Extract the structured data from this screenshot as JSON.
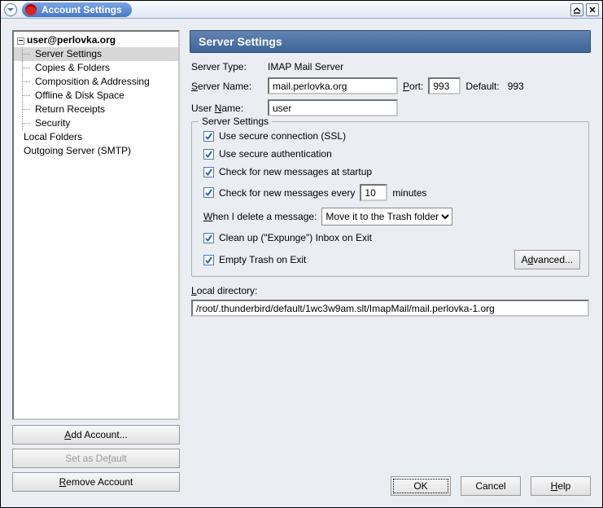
{
  "window": {
    "title": "Account Settings",
    "icons": {
      "dropdown": "dropdown-icon",
      "minimize": "minimize-icon",
      "close": "close-icon"
    }
  },
  "tree": {
    "account": "user@perlovka.org",
    "items": [
      "Server Settings",
      "Copies & Folders",
      "Composition & Addressing",
      "Offline & Disk Space",
      "Return Receipts",
      "Security"
    ],
    "selected_index": 0,
    "extra": [
      "Local Folders",
      "Outgoing Server (SMTP)"
    ]
  },
  "sidebar_buttons": {
    "add": "Add Account...",
    "set_default": "Set as Default",
    "remove": "Remove Account"
  },
  "panel": {
    "title": "Server Settings",
    "server_type_label": "Server Type:",
    "server_type_value": "IMAP Mail Server",
    "server_name_label": "Server Name:",
    "server_name_value": "mail.perlovka.org",
    "port_label": "Port:",
    "port_value": "993",
    "default_label": "Default:",
    "default_value": "993",
    "user_name_label": "User Name:",
    "user_name_value": "user"
  },
  "server_settings": {
    "legend": "Server Settings",
    "ssl": "Use secure connection (SSL)",
    "auth": "Use secure authentication",
    "check_startup": "Check for new messages at startup",
    "check_every_pre": "Check for new messages every",
    "check_every_value": "10",
    "check_every_post": "minutes",
    "delete_label": "When I delete a message:",
    "delete_value": "Move it to the Trash folder",
    "expunge": "Clean up (\"Expunge\") Inbox on Exit",
    "empty_trash": "Empty Trash on Exit",
    "advanced": "Advanced..."
  },
  "local": {
    "label": "Local directory:",
    "value": "/root/.thunderbird/default/1wc3w9am.slt/ImapMail/mail.perlovka-1.org"
  },
  "dialog": {
    "ok": "OK",
    "cancel": "Cancel",
    "help": "Help"
  }
}
